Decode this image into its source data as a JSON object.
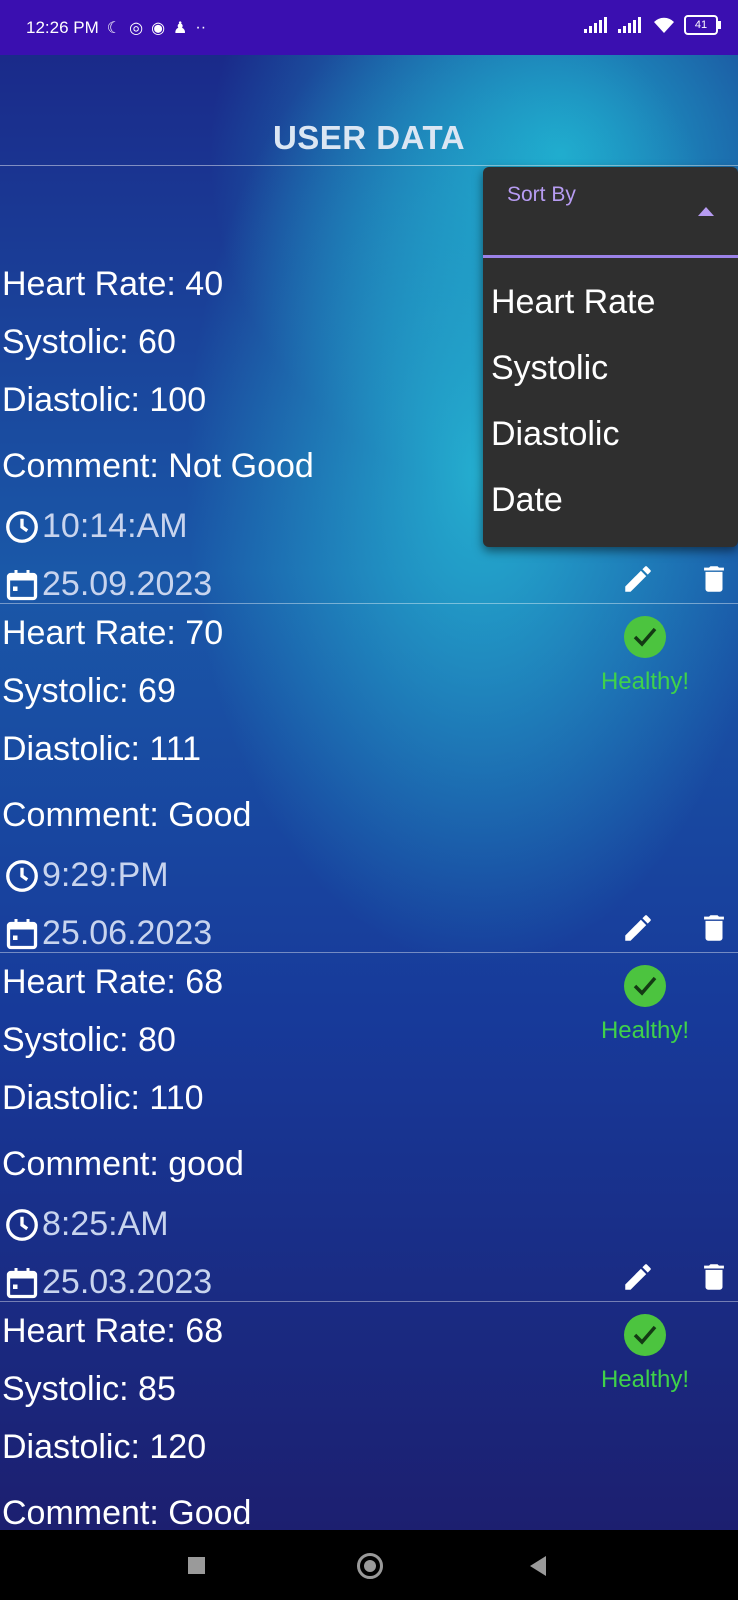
{
  "status_bar": {
    "time": "12:26 PM",
    "left_icons": [
      "moon-icon",
      "whatsapp-icon",
      "messenger-icon",
      "contact-icon",
      "more-icon"
    ],
    "battery": "41"
  },
  "app": {
    "title": "USER DATA",
    "labels": {
      "heart_rate": "Heart Rate:",
      "systolic": "Systolic:",
      "diastolic": "Diastolic:",
      "comment": "Comment:"
    }
  },
  "records": [
    {
      "heart_rate": "Heart Rate: 40",
      "systolic": "Systolic: 60",
      "diastolic": "Diastolic: 100",
      "comment": "Comment: Not Good",
      "time": "10:14:AM",
      "date": "25.09.2023",
      "status": ""
    },
    {
      "heart_rate": "Heart Rate: 70",
      "systolic": "Systolic: 69",
      "diastolic": "Diastolic: 111",
      "comment": "Comment: Good",
      "time": "9:29:PM",
      "date": "25.06.2023",
      "status": "Healthy!"
    },
    {
      "heart_rate": "Heart Rate: 68",
      "systolic": "Systolic: 80",
      "diastolic": "Diastolic: 110",
      "comment": "Comment: good",
      "time": "8:25:AM",
      "date": "25.03.2023",
      "status": "Healthy!"
    },
    {
      "heart_rate": "Heart Rate: 68",
      "systolic": "Systolic: 85",
      "diastolic": "Diastolic: 120",
      "comment": "Comment: Good",
      "status": "Healthy!"
    }
  ],
  "sort_dropdown": {
    "label": "Sort By",
    "options": [
      "Heart Rate",
      "Systolic",
      "Diastolic",
      "Date"
    ]
  },
  "colors": {
    "status_bar": "#3a0fb0",
    "healthy_green": "#3fd24a",
    "dropdown_bg": "#2f2f2f",
    "dropdown_accent": "#b79cf2"
  }
}
